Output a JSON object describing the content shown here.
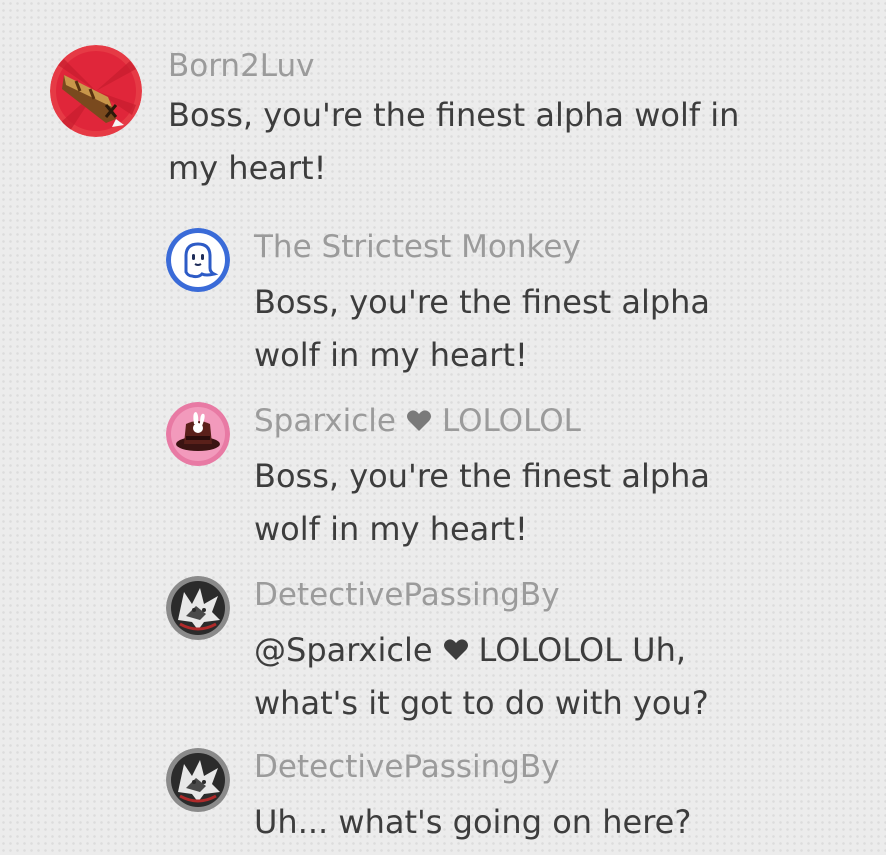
{
  "comments": [
    {
      "username": "Born2Luv",
      "text_line1": "Boss, you're the finest alpha wolf in",
      "text_line2": "my heart!",
      "avatar_icon": "horn-on-red-icon"
    },
    {
      "username": "The Strictest Monkey",
      "text_line1": "Boss, you're the finest alpha",
      "text_line2": "wolf in my heart!",
      "avatar_icon": "ghost-on-blue-icon"
    },
    {
      "username_part1": "Sparxicle",
      "username_part2": "LOLOLOL",
      "text_line1": "Boss, you're the finest alpha",
      "text_line2": "wolf in my heart!",
      "avatar_icon": "bunny-hat-on-pink-icon"
    },
    {
      "username": "DetectivePassingBy",
      "mention_part1": "@Sparxicle",
      "mention_part2": "LOLOLOL Uh,",
      "text_line2": "what's it got to do with you?",
      "avatar_icon": "wolf-on-dark-icon"
    },
    {
      "username": "DetectivePassingBy",
      "text_line1": "Uh... what's going on here?",
      "avatar_icon": "wolf-on-dark-icon"
    }
  ],
  "colors": {
    "username": "#9b9b9b",
    "text": "#3d3d3d",
    "background": "#ececec"
  }
}
